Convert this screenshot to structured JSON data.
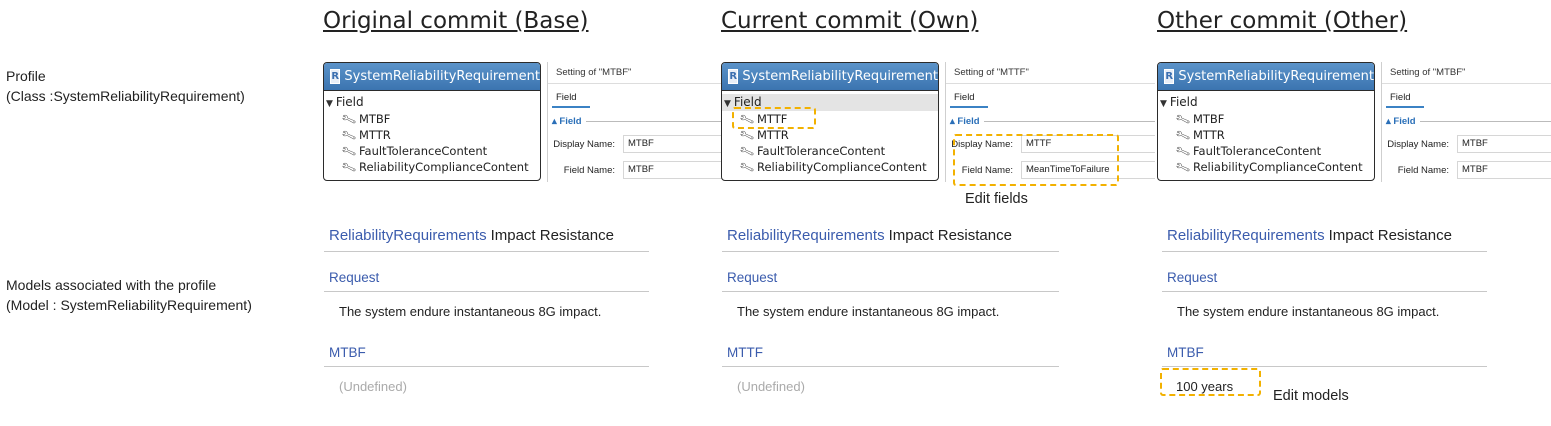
{
  "row_labels": {
    "profile": [
      "Profile",
      "(Class :SystemReliabilityRequirement)"
    ],
    "models": [
      "Models associated with the profile",
      "(Model : SystemReliabilityRequirement)"
    ]
  },
  "columns": [
    {
      "title": "Original commit (Base)",
      "class_name": "SystemReliabilityRequirement",
      "field_header": "Field",
      "fields": [
        "MTBF",
        "MTTR",
        "FaultToleranceContent",
        "ReliabilityComplianceContent"
      ],
      "setting_title": "Setting of \"MTBF\"",
      "setting_tab": "Field",
      "setting_section": "Field",
      "display_name_label": "Display Name:",
      "display_name_value": "MTBF",
      "field_name_label": "Field Name:",
      "field_name_value": "MTBF",
      "model_type": "ReliabilityRequirements",
      "model_name": "Impact Resistance",
      "request_label": "Request",
      "request_value": "The system endure instantaneous 8G impact.",
      "attr_label": "MTBF",
      "attr_value": "(Undefined)"
    },
    {
      "title": "Current commit (Own)",
      "class_name": "SystemReliabilityRequirement",
      "field_header": "Field",
      "fields": [
        "MTTF",
        "MTTR",
        "FaultToleranceContent",
        "ReliabilityComplianceContent"
      ],
      "setting_title": "Setting of \"MTTF\"",
      "setting_tab": "Field",
      "setting_section": "Field",
      "display_name_label": "Display Name:",
      "display_name_value": "MTTF",
      "field_name_label": "Field Name:",
      "field_name_value": "MeanTimeToFailure",
      "note": "Edit fields",
      "model_type": "ReliabilityRequirements",
      "model_name": "Impact Resistance",
      "request_label": "Request",
      "request_value": "The system endure instantaneous 8G impact.",
      "attr_label": "MTTF",
      "attr_value": "(Undefined)"
    },
    {
      "title": "Other commit (Other)",
      "class_name": "SystemReliabilityRequirement",
      "field_header": "Field",
      "fields": [
        "MTBF",
        "MTTR",
        "FaultToleranceContent",
        "ReliabilityComplianceContent"
      ],
      "setting_title": "Setting of \"MTBF\"",
      "setting_tab": "Field",
      "setting_section": "Field",
      "display_name_label": "Display Name:",
      "display_name_value": "MTBF",
      "field_name_label": "Field Name:",
      "field_name_value": "MTBF",
      "note": "Edit models",
      "model_type": "ReliabilityRequirements",
      "model_name": "Impact Resistance",
      "request_label": "Request",
      "request_value": "The system endure instantaneous 8G impact.",
      "attr_label": "MTBF",
      "attr_value": "100 years"
    }
  ],
  "icons": {
    "class_icon": "R",
    "expand": "triangle-down-icon",
    "field": "wrench-icon"
  },
  "colors": {
    "highlight": "#f2b100",
    "class_header": "#4a84bf",
    "link_blue": "#3b5cad"
  }
}
